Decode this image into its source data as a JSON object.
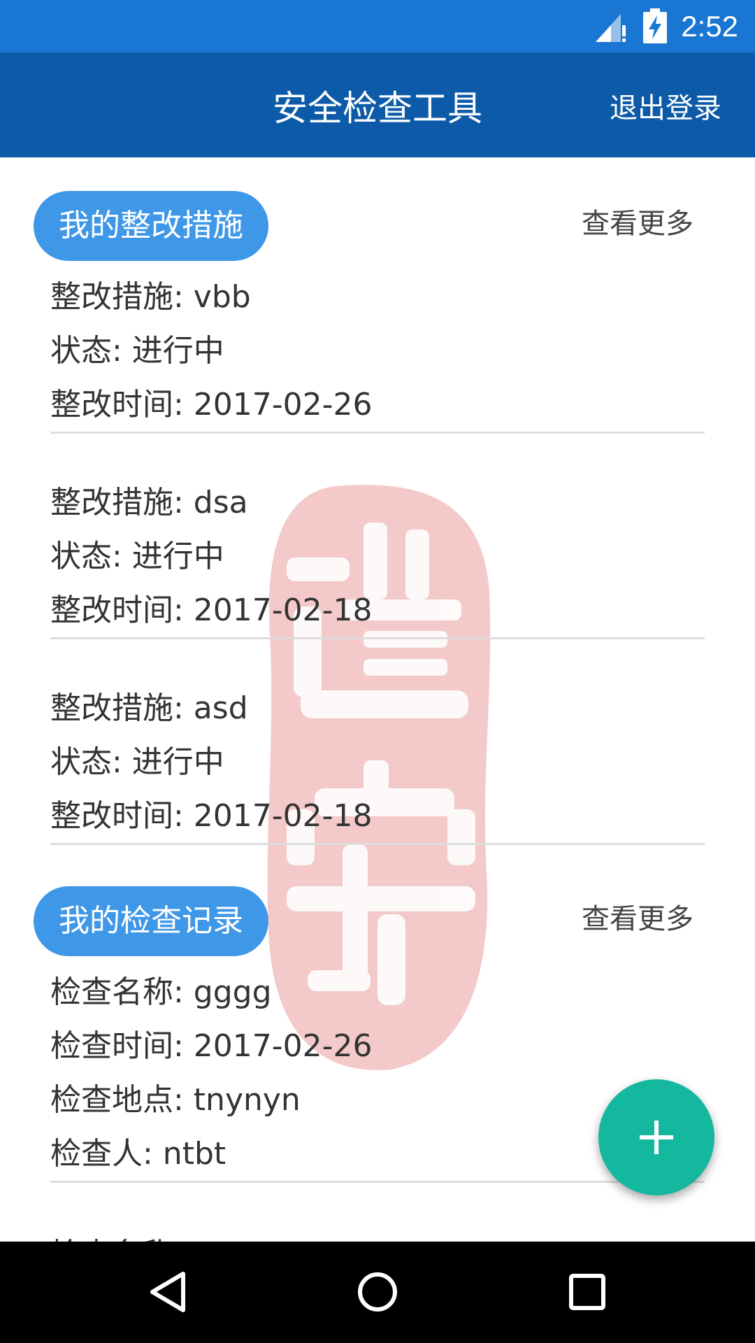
{
  "status_bar": {
    "time": "2:52"
  },
  "app_bar": {
    "title": "安全检查工具",
    "logout_label": "退出登录"
  },
  "rectification": {
    "header": "我的整改措施",
    "more_label": "查看更多",
    "items": [
      {
        "measure": "整改措施: vbb",
        "status": "状态: 进行中",
        "time": "整改时间: 2017-02-26"
      },
      {
        "measure": "整改措施: dsa",
        "status": "状态: 进行中",
        "time": "整改时间: 2017-02-18"
      },
      {
        "measure": "整改措施: asd",
        "status": "状态: 进行中",
        "time": "整改时间: 2017-02-18"
      }
    ]
  },
  "inspection": {
    "header": "我的检查记录",
    "more_label": "查看更多",
    "items": [
      {
        "name": "检查名称: gggg",
        "time": "检查时间: 2017-02-26",
        "location": "检查地点: tnynyn",
        "inspector": "检查人: ntbt"
      }
    ],
    "partial_next": "检查名称"
  },
  "fab": {
    "icon": "plus-icon"
  },
  "colors": {
    "status_bar": "#1976d2",
    "app_bar": "#0d5aa8",
    "section_pill": "#3f97e8",
    "fab": "#13b89e",
    "watermark": "#f3c9c9"
  }
}
